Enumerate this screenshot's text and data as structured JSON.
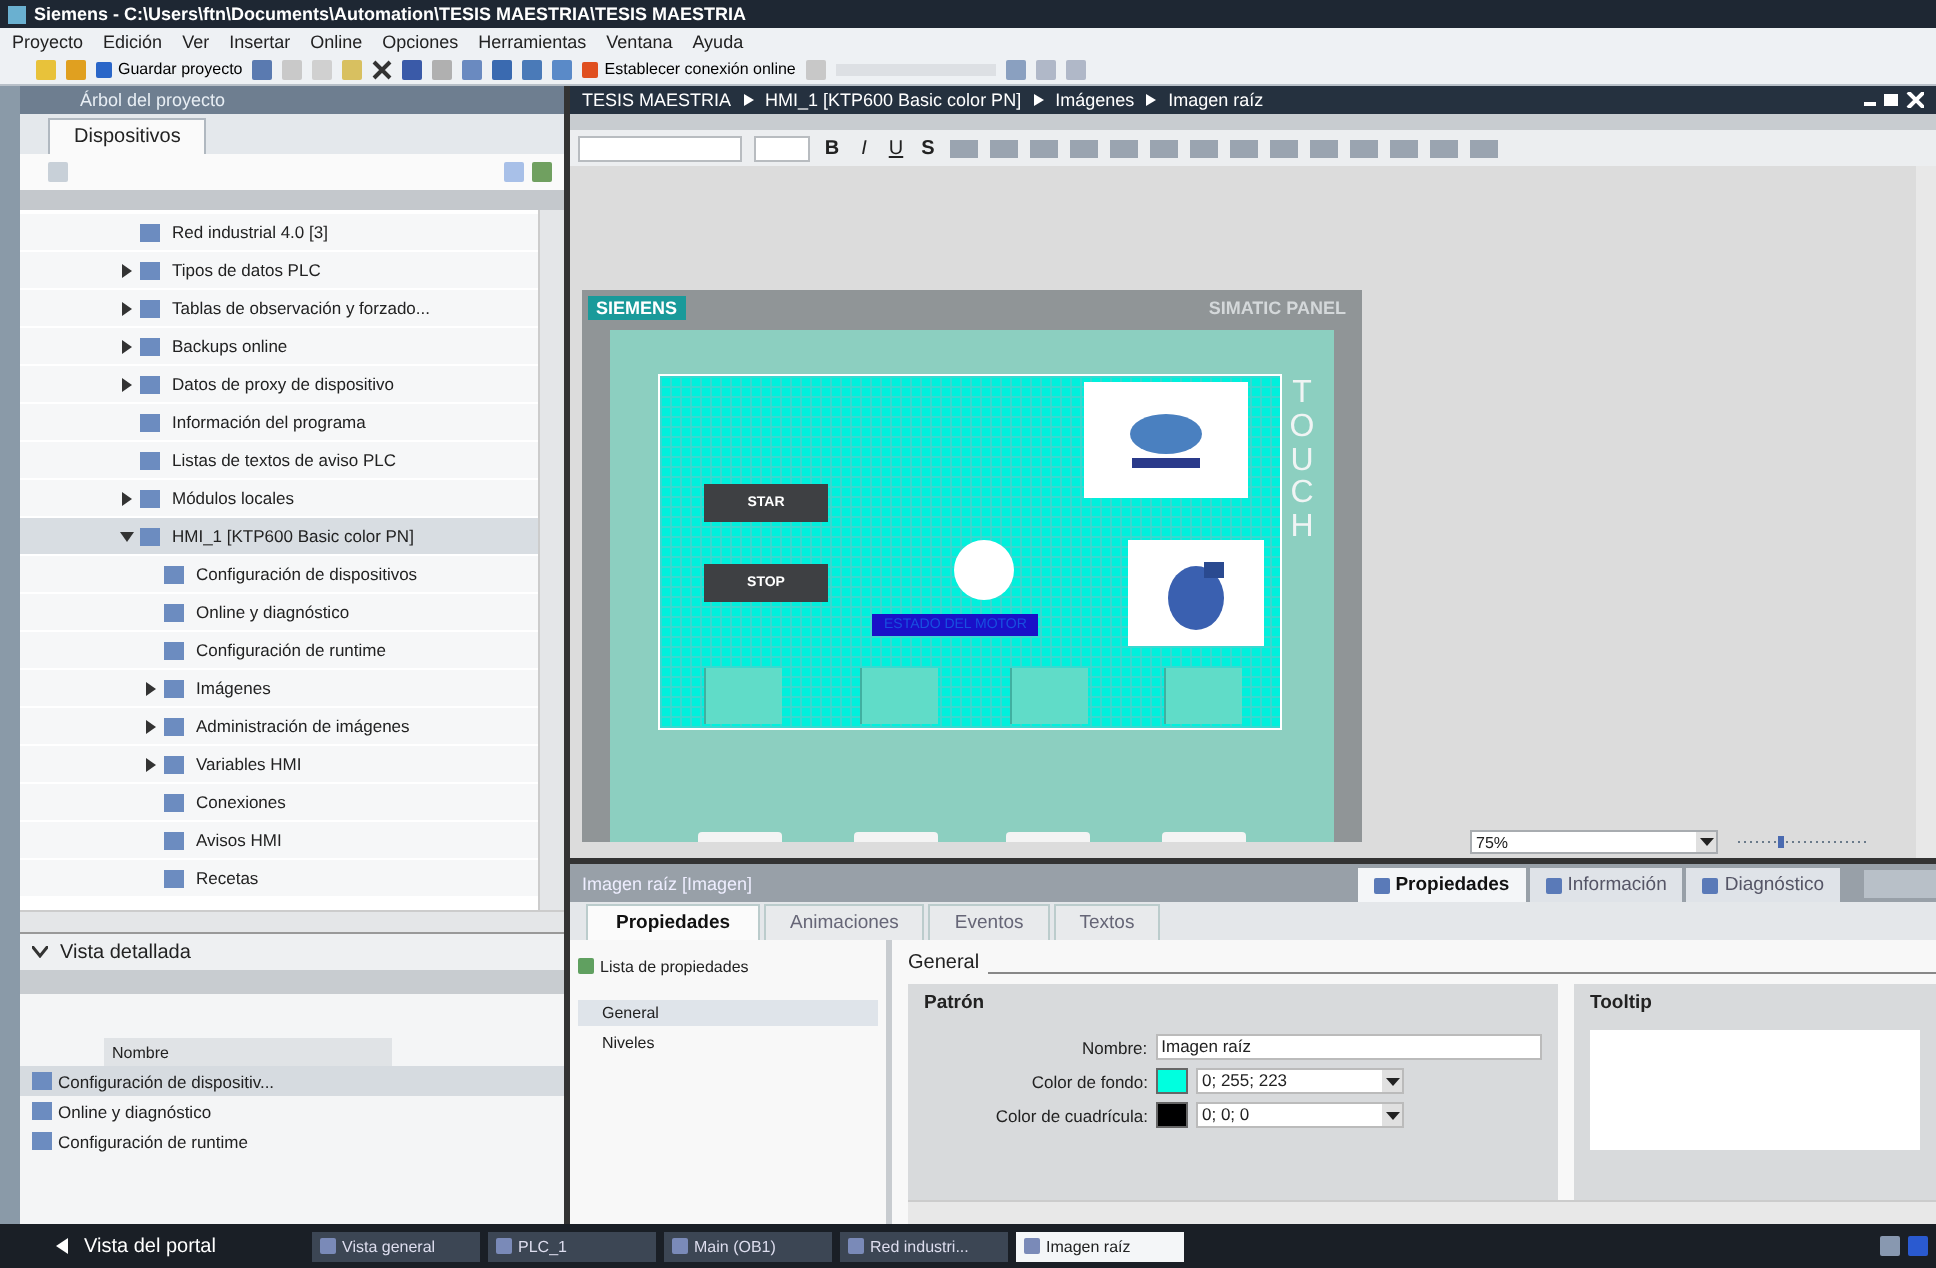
{
  "window": {
    "title": "Siemens - C:\\Users\\ftn\\Documents\\Automation\\TESIS MAESTRIA\\TESIS MAESTRIA"
  },
  "menu": [
    "Proyecto",
    "Edición",
    "Ver",
    "Insertar",
    "Online",
    "Opciones",
    "Herramientas",
    "Ventana",
    "Ayuda"
  ],
  "toolbar": {
    "save_label": "Guardar proyecto",
    "online_label": "Establecer conexión online"
  },
  "project_tree": {
    "title": "Árbol del proyecto",
    "tab": "Dispositivos",
    "items": [
      {
        "label": "Red industrial 4.0 [3]",
        "expandable": false,
        "selected": false
      },
      {
        "label": "Tipos de datos PLC",
        "expandable": true,
        "expanded": false,
        "selected": false
      },
      {
        "label": "Tablas de observación y forzado...",
        "expandable": true,
        "expanded": false,
        "selected": false
      },
      {
        "label": "Backups online",
        "expandable": true,
        "expanded": false,
        "selected": false
      },
      {
        "label": "Datos de proxy de dispositivo",
        "expandable": true,
        "expanded": false,
        "selected": false
      },
      {
        "label": "Información del programa",
        "expandable": false,
        "selected": false
      },
      {
        "label": "Listas de textos de aviso PLC",
        "expandable": false,
        "selected": false
      },
      {
        "label": "Módulos locales",
        "expandable": true,
        "expanded": false,
        "selected": false
      },
      {
        "label": "HMI_1 [KTP600 Basic color PN]",
        "expandable": true,
        "expanded": true,
        "selected": true,
        "children": [
          {
            "label": "Configuración de dispositivos",
            "expandable": false,
            "selected": false
          },
          {
            "label": "Online y diagnóstico",
            "expandable": false,
            "selected": false
          },
          {
            "label": "Configuración de runtime",
            "expandable": false,
            "selected": false
          },
          {
            "label": "Imágenes",
            "expandable": true,
            "expanded": false,
            "selected": false
          },
          {
            "label": "Administración de imágenes",
            "expandable": true,
            "expanded": false,
            "selected": false
          },
          {
            "label": "Variables HMI",
            "expandable": true,
            "expanded": false,
            "selected": false
          },
          {
            "label": "Conexiones",
            "expandable": false,
            "selected": false
          },
          {
            "label": "Avisos HMI",
            "expandable": false,
            "selected": false
          },
          {
            "label": "Recetas",
            "expandable": false,
            "selected": false
          }
        ]
      }
    ]
  },
  "detail_view": {
    "title": "Vista detallada",
    "column": "Nombre",
    "rows": [
      {
        "label": "Configuración de dispositiv...",
        "selected": true
      },
      {
        "label": "Online y diagnóstico",
        "selected": false
      },
      {
        "label": "Configuración de runtime",
        "selected": false
      }
    ]
  },
  "editor": {
    "breadcrumb": [
      "TESIS MAESTRIA",
      "HMI_1 [KTP600 Basic color PN]",
      "Imágenes",
      "Imagen raíz"
    ],
    "format_buttons": [
      "B",
      "I",
      "U",
      "S"
    ],
    "panel": {
      "brand": "SIEMENS",
      "model": "SIMATIC PANEL",
      "touch": "TOUCH",
      "buttons": [
        "STAR",
        "STOP"
      ],
      "status_label": "ESTADO DEL MOTOR"
    },
    "zoom": "75%"
  },
  "inspector": {
    "title": "Imagen raíz [Imagen]",
    "view_tabs": [
      {
        "label": "Propiedades",
        "selected": true
      },
      {
        "label": "Información",
        "selected": false
      },
      {
        "label": "Diagnóstico",
        "selected": false
      }
    ],
    "tabs": [
      {
        "label": "Propiedades",
        "selected": true
      },
      {
        "label": "Animaciones",
        "selected": false
      },
      {
        "label": "Eventos",
        "selected": false
      },
      {
        "label": "Textos",
        "selected": false
      }
    ],
    "property_list": "Lista de propiedades",
    "nav": [
      {
        "label": "General",
        "selected": true
      },
      {
        "label": "Niveles",
        "selected": false
      }
    ],
    "section": "General",
    "group": "Patrón",
    "fields": [
      {
        "kind": "text",
        "label": "Nombre:",
        "value": "Imagen raíz"
      },
      {
        "kind": "color",
        "label": "Color de fondo:",
        "value": "0; 255; 223",
        "color": "#00ffdf"
      },
      {
        "kind": "color",
        "label": "Color de cuadrícula:",
        "value": "0; 0; 0",
        "color": "#000000"
      }
    ],
    "tooltip_group": "Tooltip"
  },
  "taskbar": {
    "portal": "Vista del portal",
    "items": [
      {
        "label": "Vista general",
        "selected": false
      },
      {
        "label": "PLC_1",
        "selected": false
      },
      {
        "label": "Main (OB1)",
        "selected": false
      },
      {
        "label": "Red industri...",
        "selected": false
      },
      {
        "label": "Imagen raíz",
        "selected": true
      }
    ]
  }
}
